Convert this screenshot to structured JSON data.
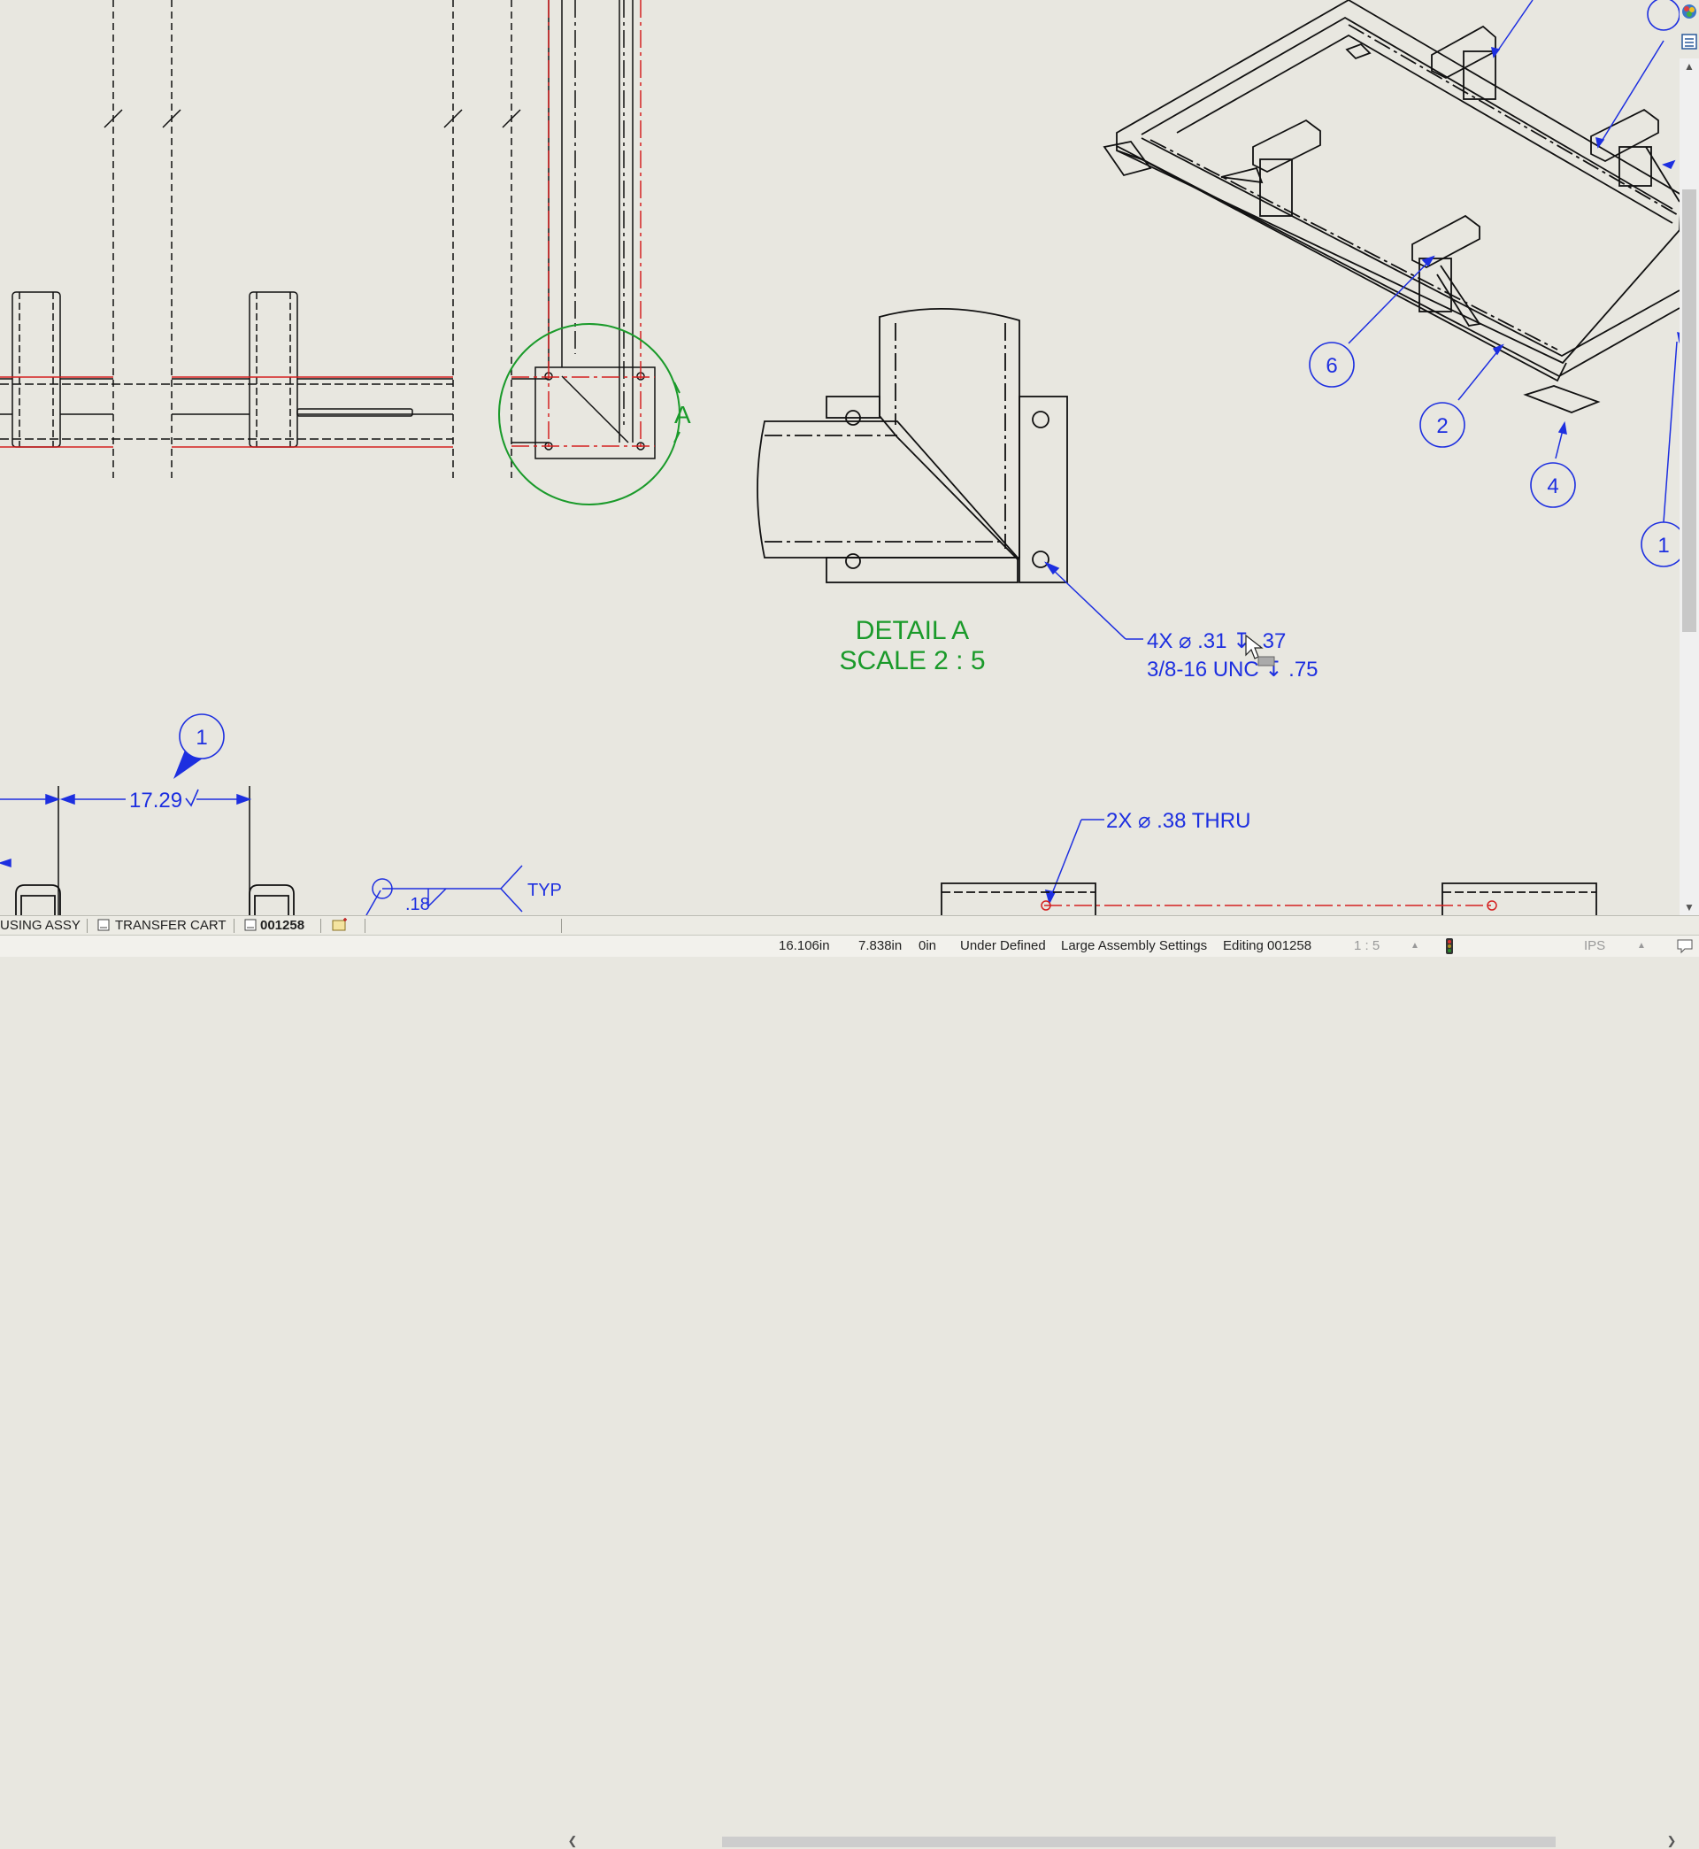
{
  "drawing": {
    "detail_title": "DETAIL A",
    "detail_scale": "SCALE 2 : 5",
    "detail_circle_label": "A",
    "hole_callout_line1": "4X ⌀ .31 ↧ .37",
    "hole_callout_line2": "3/8-16 UNC ↧ .75",
    "thru_callout": "2X ⌀ .38 THRU",
    "dimension_value": "17.29",
    "weld_size": ".18",
    "weld_note": "TYP",
    "balloons": [
      "6",
      "2",
      "4",
      "1",
      "1"
    ]
  },
  "tabs": [
    {
      "label": "USING ASSY",
      "active": false
    },
    {
      "label": "TRANSFER CART",
      "active": false
    },
    {
      "label": "001258",
      "active": true
    }
  ],
  "status": {
    "x": "16.106in",
    "y": "7.838in",
    "z": "0in",
    "definition": "Under Defined",
    "assembly_settings": "Large Assembly Settings",
    "editing": "Editing 001258",
    "scale": "1 : 5",
    "units": "IPS"
  },
  "colors": {
    "annotation": "#1d2fe0",
    "detail": "#1a9a2a",
    "centerline": "#d42020",
    "geometry": "#111111",
    "background": "#e8e7e0"
  },
  "icons": [
    "appearance-icon",
    "task-pane-icon",
    "sheet-icon",
    "add-sheet-icon",
    "rebuild-light-icon",
    "quick-tips-icon"
  ]
}
